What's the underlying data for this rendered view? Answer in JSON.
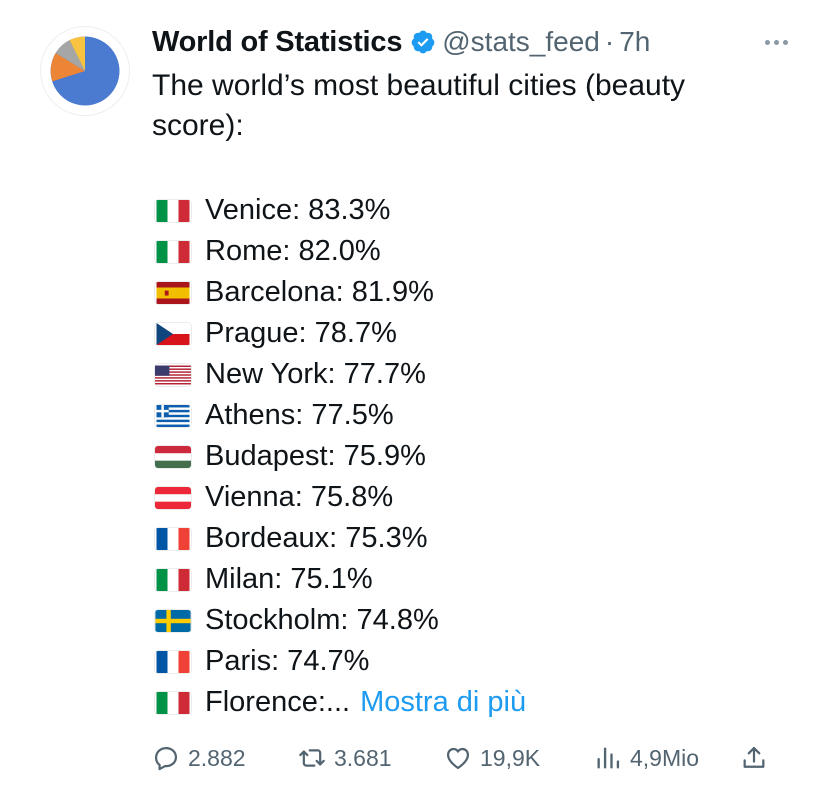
{
  "author": {
    "name": "World of Statistics",
    "handle": "@stats_feed",
    "separator": "·",
    "time": "7h"
  },
  "tweet": {
    "text": "The world’s most beautiful cities (beauty score):",
    "items": [
      {
        "flag": "italy",
        "text": "Venice: 83.3%"
      },
      {
        "flag": "italy",
        "text": "Rome: 82.0%"
      },
      {
        "flag": "spain",
        "text": "Barcelona: 81.9%"
      },
      {
        "flag": "czechia",
        "text": "Prague: 78.7%"
      },
      {
        "flag": "usa",
        "text": "New York: 77.7%"
      },
      {
        "flag": "greece",
        "text": "Athens: 77.5%"
      },
      {
        "flag": "hungary",
        "text": "Budapest: 75.9%"
      },
      {
        "flag": "austria",
        "text": "Vienna: 75.8%"
      },
      {
        "flag": "france",
        "text": "Bordeaux: 75.3%"
      },
      {
        "flag": "italy",
        "text": "Milan: 75.1%"
      },
      {
        "flag": "sweden",
        "text": "Stockholm: 74.8%"
      },
      {
        "flag": "france",
        "text": "Paris: 74.7%"
      },
      {
        "flag": "italy",
        "text": "Florence:..."
      }
    ],
    "show_more": "Mostra di più"
  },
  "actions": {
    "replies": "2.882",
    "reposts": "3.681",
    "likes": "19,9K",
    "views": "4,9Mio"
  },
  "icons": {
    "avatar": "pie-chart-avatar",
    "verified": "verified-badge-icon",
    "more": "more-options-icon",
    "reply": "reply-icon",
    "repost": "repost-icon",
    "like": "heart-icon",
    "views": "views-icon",
    "share": "share-icon"
  },
  "colors": {
    "link": "#1d9bf0",
    "secondary_text": "#536471",
    "verified": "#1d9bf0"
  }
}
